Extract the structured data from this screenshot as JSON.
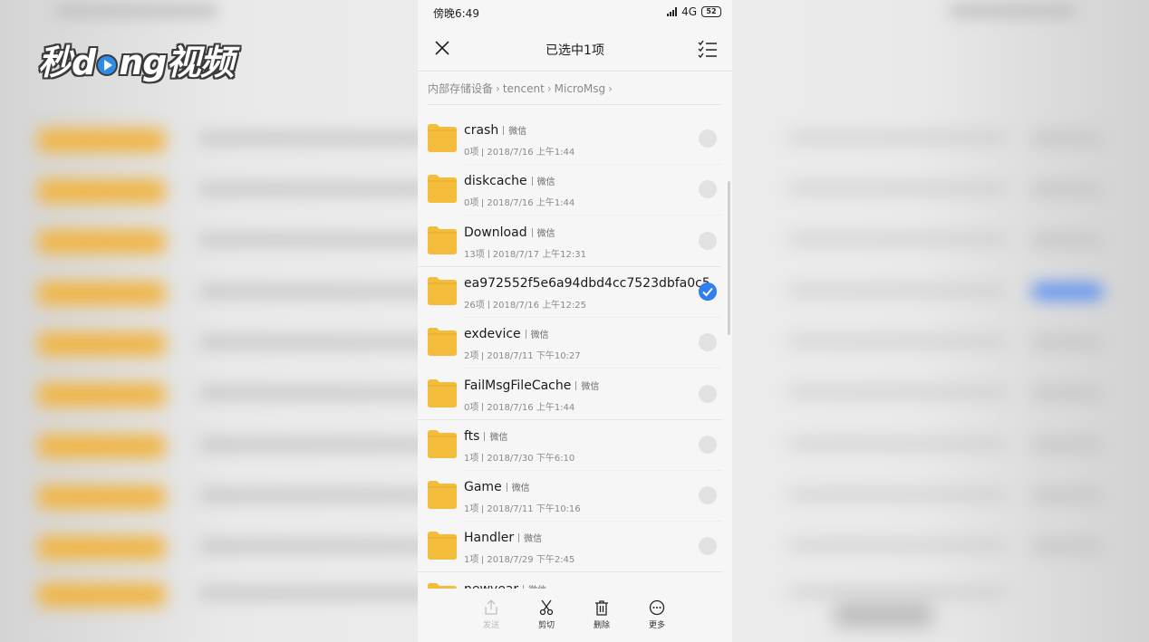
{
  "watermark": {
    "text_a": "秒",
    "text_b": "d",
    "text_c": "ng视频"
  },
  "status_bar": {
    "time": "傍晚6:49",
    "network": "4G",
    "battery": "52"
  },
  "header": {
    "title": "已选中1项"
  },
  "breadcrumb": [
    "内部存储设备",
    "tencent",
    "MicroMsg"
  ],
  "files": [
    {
      "name": "crash",
      "tag": "微信",
      "count": "0项",
      "date": "2018/7/16 上午1:44",
      "selected": false
    },
    {
      "name": "diskcache",
      "tag": "微信",
      "count": "0项",
      "date": "2018/7/16 上午1:44",
      "selected": false
    },
    {
      "name": "Download",
      "tag": "微信",
      "count": "13项",
      "date": "2018/7/17 上午12:31",
      "selected": false
    },
    {
      "name": "ea972552f5e6a94dbd4cc7523dbfa0c5",
      "tag": "",
      "count": "26项",
      "date": "2018/7/16 上午12:25",
      "selected": true
    },
    {
      "name": "exdevice",
      "tag": "微信",
      "count": "2项",
      "date": "2018/7/11 下午10:27",
      "selected": false
    },
    {
      "name": "FailMsgFileCache",
      "tag": "微信",
      "count": "0项",
      "date": "2018/7/16 上午1:44",
      "selected": false
    },
    {
      "name": "fts",
      "tag": "微信",
      "count": "1项",
      "date": "2018/7/30 下午6:10",
      "selected": false
    },
    {
      "name": "Game",
      "tag": "微信",
      "count": "1项",
      "date": "2018/7/11 下午10:16",
      "selected": false
    },
    {
      "name": "Handler",
      "tag": "微信",
      "count": "1项",
      "date": "2018/7/29 下午2:45",
      "selected": false
    },
    {
      "name": "newyear",
      "tag": "微信",
      "count": "",
      "date": "",
      "selected": false
    }
  ],
  "actions": {
    "send": "发送",
    "cut": "剪切",
    "delete": "删除",
    "more": "更多"
  },
  "colors": {
    "folder": "#f3bd3b",
    "accent": "#2f7ff0"
  }
}
